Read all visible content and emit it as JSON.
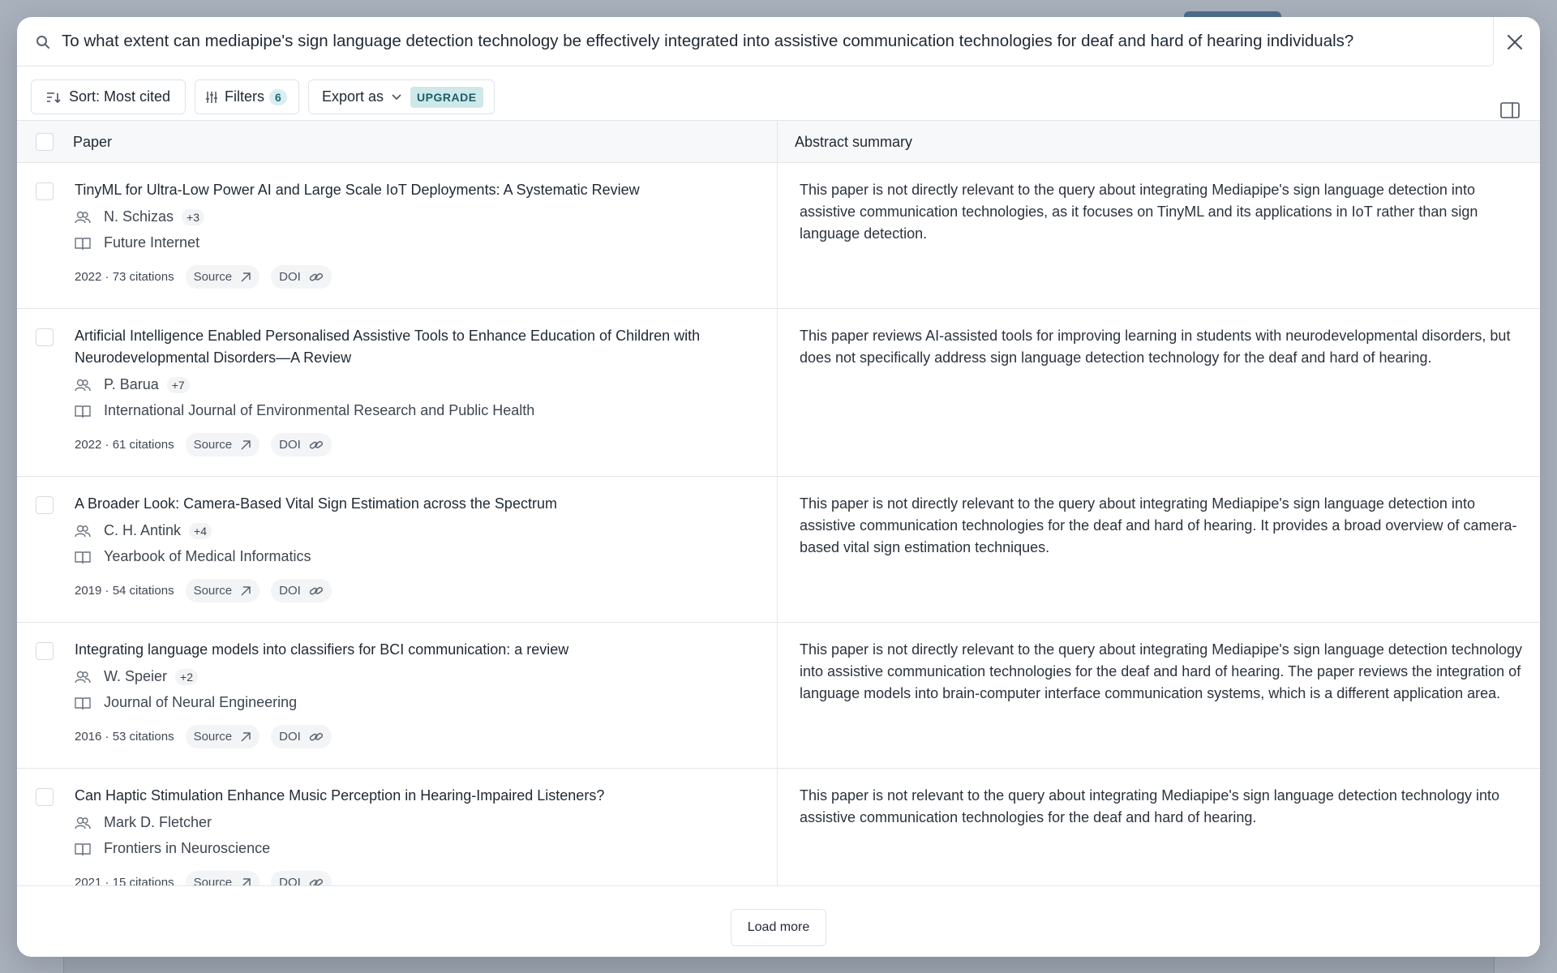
{
  "search": {
    "query": "To what extent can mediapipe's sign language detection technology be effectively integrated into assistive communication technologies for deaf and hard of hearing individuals?"
  },
  "toolbar": {
    "sort_label": "Sort: Most cited",
    "filters_label": "Filters",
    "filters_count": "6",
    "export_label": "Export as",
    "upgrade_label": "UPGRADE"
  },
  "table": {
    "col_paper": "Paper",
    "col_summary": "Abstract summary",
    "rows": [
      {
        "title": "TinyML for Ultra-Low Power AI and Large Scale IoT Deployments: A Systematic Review",
        "author": "N. Schizas",
        "more_authors": "+3",
        "journal": "Future Internet",
        "year_citations": "2022 · 73 citations",
        "summary": "This paper is not directly relevant to the query about integrating Mediapipe's sign language detection into assistive communication technologies, as it focuses on TinyML and its applications in IoT rather than sign language detection."
      },
      {
        "title": "Artificial Intelligence Enabled Personalised Assistive Tools to Enhance Education of Children with Neurodevelopmental Disorders—A Review",
        "author": "P. Barua",
        "more_authors": "+7",
        "journal": "International Journal of Environmental Research and Public Health",
        "year_citations": "2022 · 61 citations",
        "summary": "This paper reviews AI-assisted tools for improving learning in students with neurodevelopmental disorders, but does not specifically address sign language detection technology for the deaf and hard of hearing."
      },
      {
        "title": "A Broader Look: Camera-Based Vital Sign Estimation across the Spectrum",
        "author": "C. H. Antink",
        "more_authors": "+4",
        "journal": "Yearbook of Medical Informatics",
        "year_citations": "2019 · 54 citations",
        "summary": "This paper is not directly relevant to the query about integrating Mediapipe's sign language detection into assistive communication technologies for the deaf and hard of hearing. It provides a broad overview of camera-based vital sign estimation techniques."
      },
      {
        "title": "Integrating language models into classifiers for BCI communication: a review",
        "author": "W. Speier",
        "more_authors": "+2",
        "journal": "Journal of Neural Engineering",
        "year_citations": "2016 · 53 citations",
        "summary": "This paper is not directly relevant to the query about integrating Mediapipe's sign language detection technology into assistive communication technologies for the deaf and hard of hearing. The paper reviews the integration of language models into brain-computer interface communication systems, which is a different application area."
      },
      {
        "title": "Can Haptic Stimulation Enhance Music Perception in Hearing-Impaired Listeners?",
        "author": "Mark D. Fletcher",
        "more_authors": "",
        "journal": "Frontiers in Neuroscience",
        "year_citations": "2021 · 15 citations",
        "summary": "This paper is not relevant to the query about integrating Mediapipe's sign language detection technology into assistive communication technologies for the deaf and hard of hearing."
      }
    ],
    "source_label": "Source",
    "doi_label": "DOI"
  },
  "load_more_label": "Load more"
}
